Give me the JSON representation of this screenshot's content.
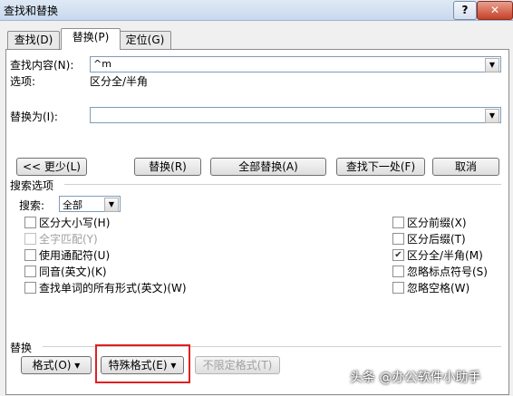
{
  "window": {
    "title": "查找和替换",
    "help_label": "?",
    "close_label": "✕"
  },
  "tabs": [
    {
      "label": "查找(D)",
      "active": false
    },
    {
      "label": "替换(P)",
      "active": true
    },
    {
      "label": "定位(G)",
      "active": false
    }
  ],
  "find": {
    "label": "查找内容(N):",
    "value": "^m",
    "options_label": "选项:",
    "options_value": "区分全/半角"
  },
  "replace": {
    "label": "替换为(I):",
    "value": ""
  },
  "buttons": {
    "less": "<< 更少(L)",
    "replace": "替换(R)",
    "replace_all": "全部替换(A)",
    "find_next": "查找下一处(F)",
    "cancel": "取消"
  },
  "search_options": {
    "section_label": "搜索选项",
    "search_label": "搜索:",
    "search_value": "全部"
  },
  "checkboxes_left": [
    {
      "label": "区分大小写(H)",
      "checked": false,
      "disabled": false
    },
    {
      "label": "全字匹配(Y)",
      "checked": false,
      "disabled": true
    },
    {
      "label": "使用通配符(U)",
      "checked": false,
      "disabled": false
    },
    {
      "label": "同音(英文)(K)",
      "checked": false,
      "disabled": false
    },
    {
      "label": "查找单词的所有形式(英文)(W)",
      "checked": false,
      "disabled": false
    }
  ],
  "checkboxes_right": [
    {
      "label": "区分前缀(X)",
      "checked": false
    },
    {
      "label": "区分后缀(T)",
      "checked": false
    },
    {
      "label": "区分全/半角(M)",
      "checked": true
    },
    {
      "label": "忽略标点符号(S)",
      "checked": false
    },
    {
      "label": "忽略空格(W)",
      "checked": false
    }
  ],
  "replace_section": {
    "label": "替换",
    "format": "格式(O) ▾",
    "special_format": "特殊格式(E) ▾",
    "no_format": "不限定格式(T)"
  },
  "watermark": "头条 @办公软件小助手",
  "colors": {
    "highlight": "#e02020",
    "title_bar": "#c9d9ee"
  }
}
